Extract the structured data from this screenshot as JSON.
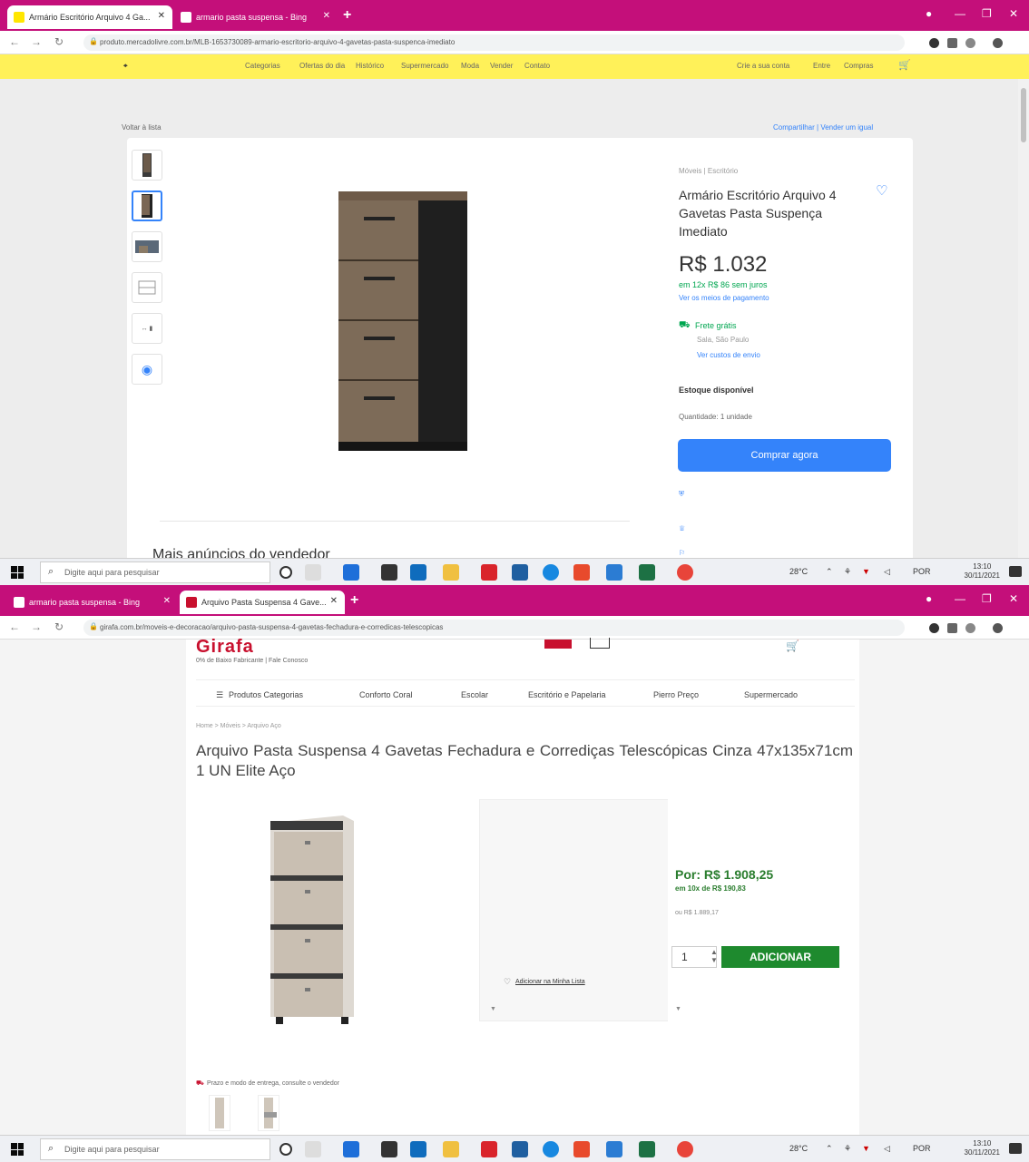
{
  "screen1": {
    "tabs": [
      {
        "label": "Armário Escritório Arquivo 4 Ga...",
        "active": true
      },
      {
        "label": "armario pasta suspensa - Bing",
        "active": false
      }
    ],
    "url": "produto.mercadolivre.com.br/MLB-1653730089-armario-escritorio-arquivo-4-gavetas-pasta-suspenca-imediato",
    "ml": {
      "nav": [
        "Categorias",
        "Ofertas do dia",
        "Histórico",
        "Supermercado",
        "Moda",
        "Vender",
        "Contato"
      ],
      "nav_right": [
        "Crie a sua conta",
        "Entre",
        "Compras"
      ],
      "breadcrumb_top": "Voltar à lista",
      "share": "Compartilhar | Vender um igual",
      "breadcrumb": "Móveis | Escritório",
      "title": "Armário Escritório Arquivo 4 Gavetas Pasta Suspença Imediato",
      "price": "R$ 1.032",
      "installments": "em 12x R$ 86 sem juros",
      "payments_link": "Ver os meios de pagamento",
      "shipping": "Frete grátis",
      "shipping_location": "Sala, São Paulo",
      "shipping_link": "Ver custos de envio",
      "stock": "Estoque disponível",
      "quantity": "Quantidade: 1 unidade",
      "buy_button": "Comprar agora",
      "more_ads": "Mais anúncios do vendedor"
    },
    "taskbar": {
      "search_placeholder": "Digite aqui para pesquisar",
      "temperature": "28°C",
      "lang": "POR",
      "time": "13:10",
      "date": "30/11/2021"
    }
  },
  "screen2": {
    "tabs": [
      {
        "label": "armario pasta suspensa - Bing",
        "active": false
      },
      {
        "label": "Arquivo Pasta Suspensa 4 Gave...",
        "active": true
      }
    ],
    "url": "girafa.com.br/moveis-e-decoracao/arquivo-pasta-suspensa-4-gavetas-fechadura-e-corredicas-telescopicas",
    "girafa": {
      "logo": "Girafa",
      "logo_sub": "0% de Baixo Fabricante | Fale Conosco",
      "nav": [
        "Produtos Categorias",
        "Conforto Coral",
        "Escolar",
        "Escritório e Papelaria",
        "Pierro Preço",
        "Supermercado"
      ],
      "breadcrumb": "Home > Móveis > Arquivo Aço",
      "title": "Arquivo Pasta Suspensa 4 Gavetas Fechadura e Corrediças Telescópicas Cinza 47x135x71cm 1 UN Elite Aço",
      "price": "Por: R$ 1.908,25",
      "installment": "em 10x de R$ 190,83",
      "cash_price": "ou R$ 1.889,17",
      "quantity": "1",
      "add_button": "ADICIONAR",
      "wishlist": "Adicionar na Minha Lista",
      "delivery_note": "Prazo e modo de entrega, consulte o vendedor"
    },
    "taskbar": {
      "search_placeholder": "Digite aqui para pesquisar",
      "temperature": "28°C",
      "lang": "POR",
      "time": "13:10",
      "date": "30/11/2021"
    }
  },
  "colors": {
    "tabstrip": "#c40f7a",
    "ml_yellow": "#fff159",
    "ml_blue": "#3483fa",
    "girafa_green": "#1e8a2e",
    "girafa_red": "#c8102e"
  }
}
